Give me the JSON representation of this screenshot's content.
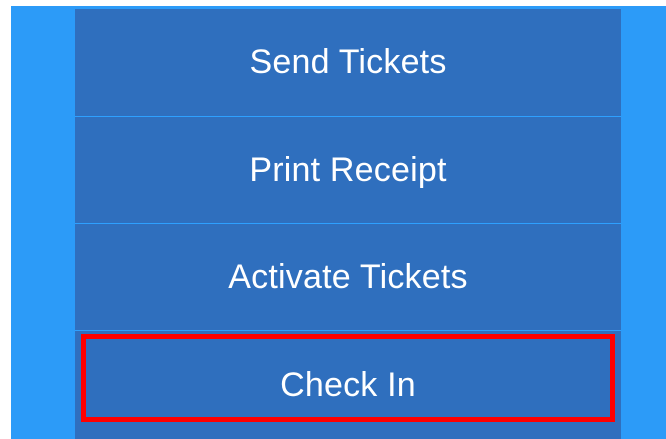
{
  "menu": {
    "items": [
      {
        "label": "Send Tickets"
      },
      {
        "label": "Print Receipt"
      },
      {
        "label": "Activate Tickets"
      },
      {
        "label": "Check In"
      }
    ]
  },
  "colors": {
    "background_blue": "#2c9bf8",
    "item_fill": "#2f6fbe",
    "divider": "#2ea0ff",
    "highlight_border": "#ff0000"
  }
}
